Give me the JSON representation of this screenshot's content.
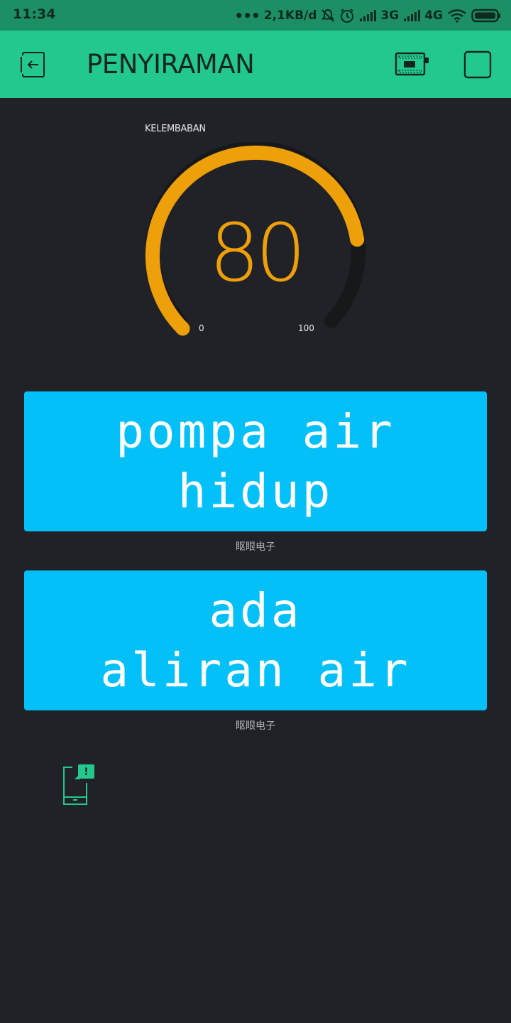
{
  "status_bar": {
    "time": "11:34",
    "speed": "2,1KB/d",
    "network_1": "3G",
    "network_2": "4G"
  },
  "app_bar": {
    "title": "PENYIRAMAN"
  },
  "gauge": {
    "label": "KELEMBABAN",
    "value": "80",
    "value_fraction": 0.8,
    "min": "0",
    "max": "100",
    "color": "#eea00a",
    "track_color": "#17181b"
  },
  "lcd_1": {
    "line1": "pompa air",
    "line2": "hidup",
    "caption": "眍眼电子",
    "color": "#04c0f8"
  },
  "lcd_2": {
    "line1": "ada",
    "line2": "aliran air",
    "caption": "眍眼电子",
    "color": "#04c0f8"
  },
  "colors": {
    "accent": "#22c88e",
    "background": "#212227"
  }
}
